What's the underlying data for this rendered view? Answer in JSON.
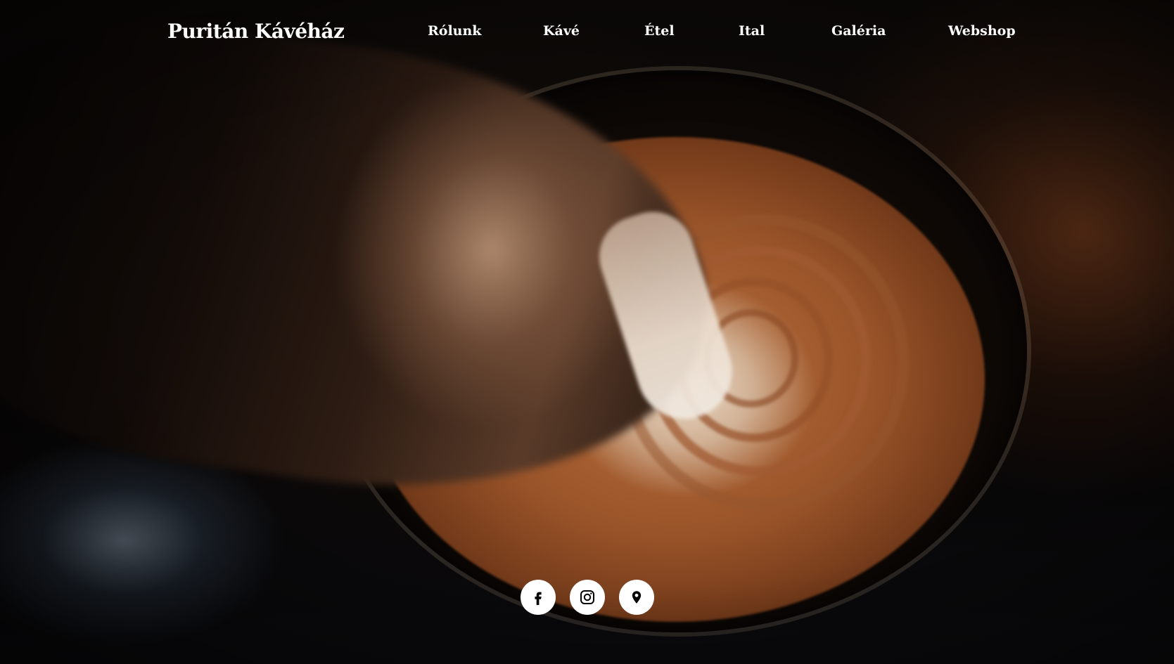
{
  "header": {
    "brand": "Puritán Kávéház"
  },
  "nav": {
    "items": [
      {
        "label": "Rólunk"
      },
      {
        "label": "Kávé"
      },
      {
        "label": "Étel"
      },
      {
        "label": "Ital"
      },
      {
        "label": "Galéria"
      },
      {
        "label": "Webshop"
      }
    ]
  },
  "social": {
    "icons": [
      "facebook-icon",
      "instagram-icon",
      "map-pin-icon"
    ]
  },
  "colors": {
    "nav_text": "#ffffff",
    "icon_bg": "#ffffff",
    "icon_fg": "#000000"
  }
}
